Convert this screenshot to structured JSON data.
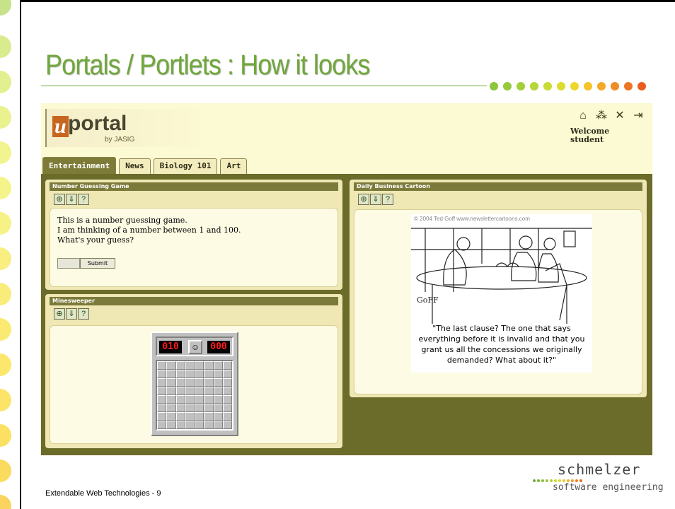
{
  "slide": {
    "title": "Portals / Portlets : How it looks",
    "footer": "Extendable Web Technologies - 9",
    "accent_color": "#6fa83a"
  },
  "portal": {
    "logo_letter": "u",
    "logo_text": "portal",
    "logo_by": "by JASIG",
    "header_icons": [
      "home-icon",
      "sitemap-icon",
      "tools-icon",
      "logout-icon"
    ],
    "welcome_line1": "Welcome",
    "welcome_line2": "student",
    "tabs": [
      {
        "label": "Entertainment",
        "active": true
      },
      {
        "label": "News",
        "active": false
      },
      {
        "label": "Biology 101",
        "active": false
      },
      {
        "label": "Art",
        "active": false
      }
    ],
    "portlets": {
      "guess": {
        "title": "Number Guessing Game",
        "line1": "This is a number guessing game.",
        "line2": "I am thinking of a number between 1 and 100.",
        "line3": "What's your guess?",
        "submit_label": "Submit"
      },
      "mines": {
        "title": "Minesweeper",
        "counter_left": "010",
        "counter_right": "000"
      },
      "cartoon": {
        "title": "Daily Business Cartoon",
        "credit": "© 2004 Ted Goff www.newslettercartoons.com",
        "caption": "\"The last clause? The one that says everything before it is invalid and that you grant us all the concessions we originally demanded? What about it?\""
      }
    },
    "toolbar_icons": [
      "zoom-icon",
      "download-icon",
      "help-icon"
    ]
  },
  "brand": {
    "name": "schmelzer",
    "sub": "software engineering"
  }
}
